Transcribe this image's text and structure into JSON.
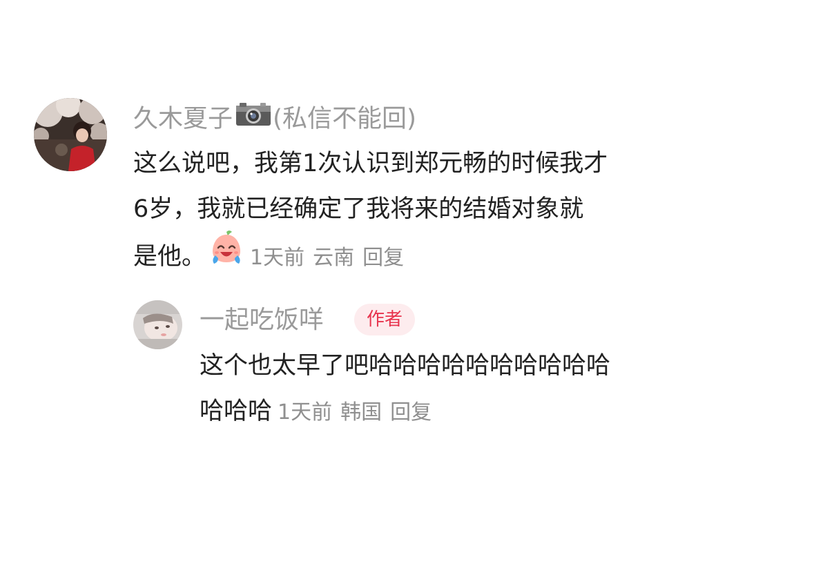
{
  "comment": {
    "username": "久木夏子",
    "username_suffix": "(私信不能回)",
    "name_icon": "camera-icon",
    "lines": [
      "这么说吧，我第1次认识到郑元畅的时候我才",
      "6岁，我就已经确定了我将来的结婚对象就",
      "是他。"
    ],
    "emoji": "crying-laughing-peach-emoji",
    "time": "1天前",
    "location": "云南",
    "reply_label": "回复"
  },
  "reply": {
    "username": "一起吃饭咩",
    "badge": "作者",
    "lines": [
      "这个也太早了吧哈哈哈哈哈哈哈哈哈哈",
      "哈哈哈"
    ],
    "time": "1天前",
    "location": "韩国",
    "reply_label": "回复"
  },
  "colors": {
    "username": "#9a9a9a",
    "meta": "#8f8f8f",
    "badge_text": "#e8344e",
    "badge_bg": "#fdecee"
  }
}
